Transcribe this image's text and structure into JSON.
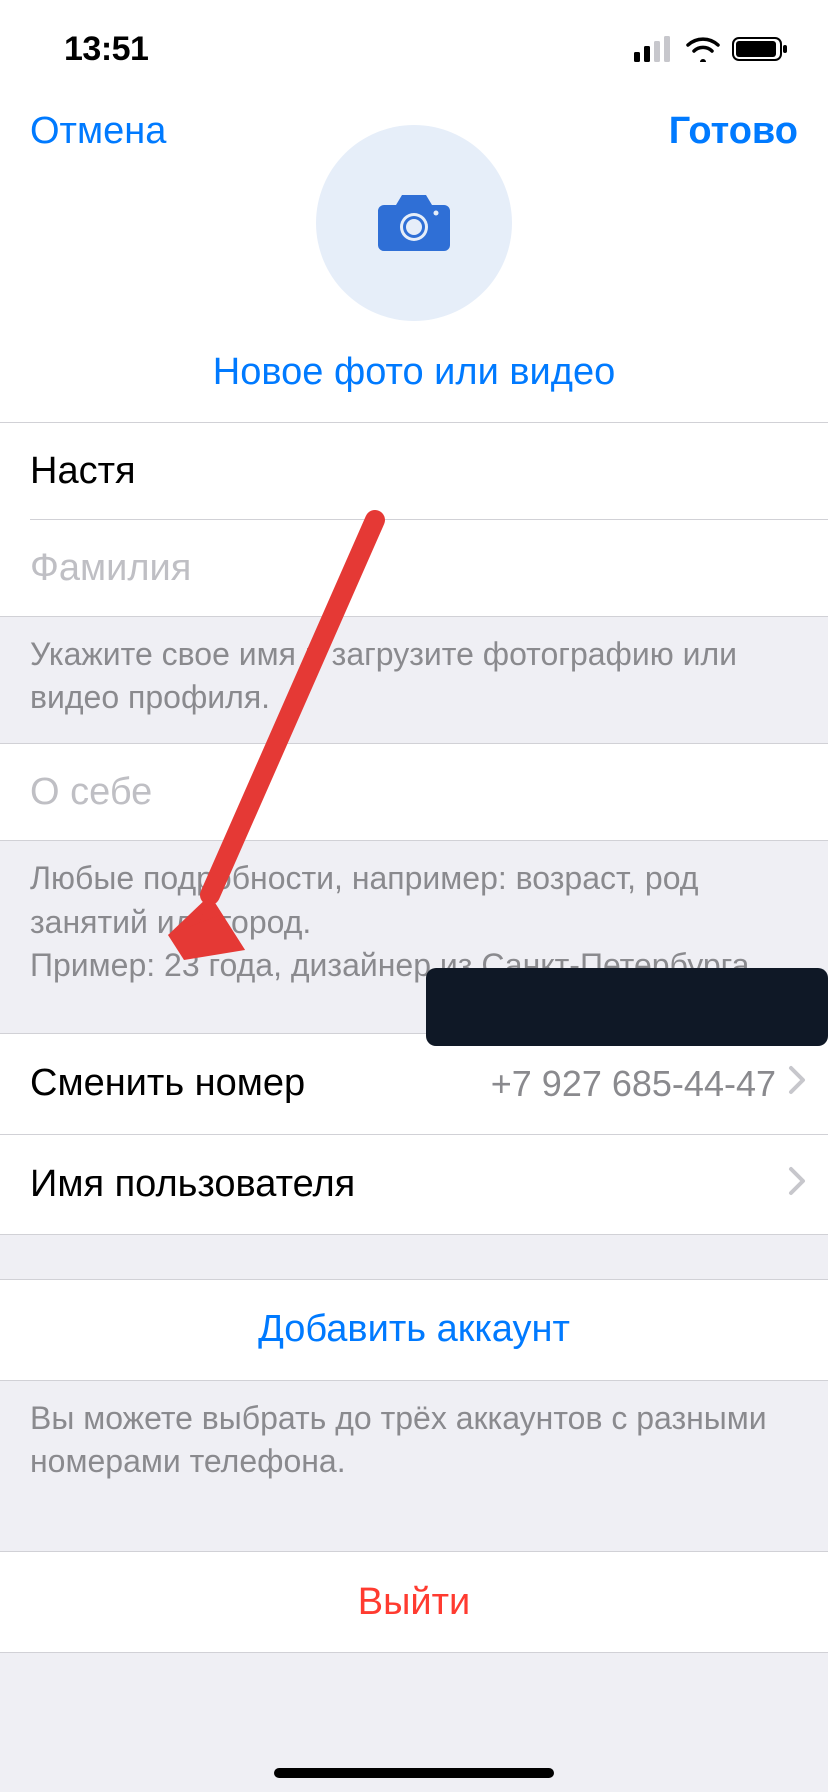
{
  "status": {
    "time": "13:51"
  },
  "nav": {
    "cancel": "Отмена",
    "done": "Готово"
  },
  "photo": {
    "link": "Новое фото или видео"
  },
  "name": {
    "first_value": "Настя",
    "last_placeholder": "Фамилия",
    "hint": "Укажите свое имя и загрузите фотографию или видео профиля."
  },
  "bio": {
    "placeholder": "О себе",
    "hint1": "Любые подробности, например: возраст, род занятий или город.",
    "hint2": "Пример: 23 года, дизайнер из Санкт-Петербурга."
  },
  "phone": {
    "label": "Сменить номер",
    "value": "+7 927 685-44-47"
  },
  "username": {
    "label": "Имя пользователя",
    "value": ""
  },
  "add_account": {
    "label": "Добавить аккаунт",
    "hint": "Вы можете выбрать до трёх аккаунтов с разными номерами телефона."
  },
  "logout": {
    "label": "Выйти"
  },
  "colors": {
    "accent": "#007aff",
    "danger": "#ff3b30",
    "bg": "#efeff4"
  }
}
